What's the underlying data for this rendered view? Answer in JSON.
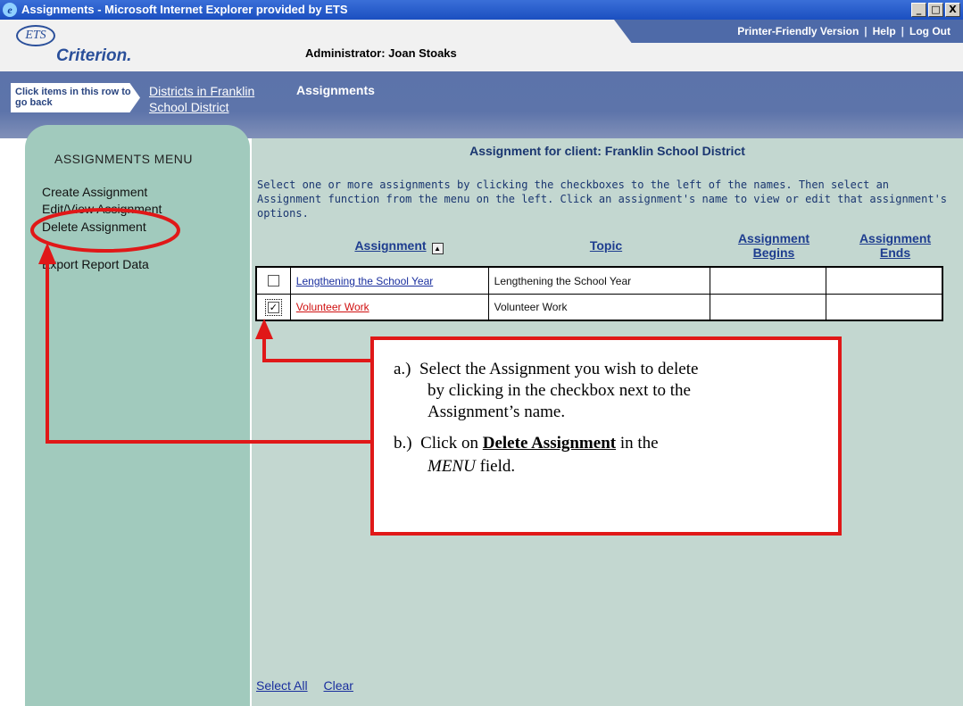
{
  "window": {
    "title": "Assignments - Microsoft Internet Explorer provided by ETS",
    "controls": [
      "_",
      "□",
      "X"
    ]
  },
  "header": {
    "logo_ets": "ETS",
    "logo_name": "Criterion.",
    "admin": "Administrator: Joan Stoaks",
    "links": [
      "Printer-Friendly Version",
      "Help",
      "Log Out"
    ],
    "link_separator": "|"
  },
  "breadcrumb": {
    "back_hint": "Click items in this row to go back",
    "link_line1": "Districts in Franklin",
    "link_line2": "School District",
    "current": "Assignments"
  },
  "menu": {
    "title": "ASSIGNMENTS MENU",
    "items": [
      "Create Assignment",
      "Edit/View Assignment",
      "Delete Assignment",
      "Export Report Data"
    ]
  },
  "main": {
    "client_title": "Assignment for client: Franklin School District",
    "instructions": "Select one or more assignments by clicking the checkboxes to the left of the names. Then select an Assignment function from the menu on the left. Click an assignment's name to view or edit that assignment's options.",
    "columns": {
      "assignment": "Assignment",
      "topic": "Topic",
      "begins_line1": "Assignment",
      "begins_line2": "Begins",
      "ends_line1": "Assignment",
      "ends_line2": "Ends"
    },
    "rows": [
      {
        "checked": false,
        "checkbox_glyph": "",
        "assignment": "Lengthening the School Year",
        "topic": "Lengthening the School Year",
        "begins": "",
        "ends": ""
      },
      {
        "checked": true,
        "checkbox_glyph": "✓",
        "assignment": "Volunteer Work",
        "topic": "Volunteer Work",
        "begins": "",
        "ends": ""
      }
    ],
    "footer_links": [
      "Select All",
      "Clear"
    ]
  },
  "callout": {
    "a_prefix": "a.)",
    "a_line1": "Select the Assignment you wish to delete",
    "a_line2": "by clicking in the checkbox next to the",
    "a_line3": "Assignment’s name.",
    "b_prefix": "b.)",
    "b_text1": "Click on",
    "b_bold": "Delete Assignment",
    "b_text2": "in the",
    "b_italic": "MENU",
    "b_text3": "field."
  },
  "colors": {
    "annotation": "#e01818",
    "menu_bg": "#a1cabd",
    "content_bg": "#c3d7d0",
    "band": "#5c73aa"
  }
}
